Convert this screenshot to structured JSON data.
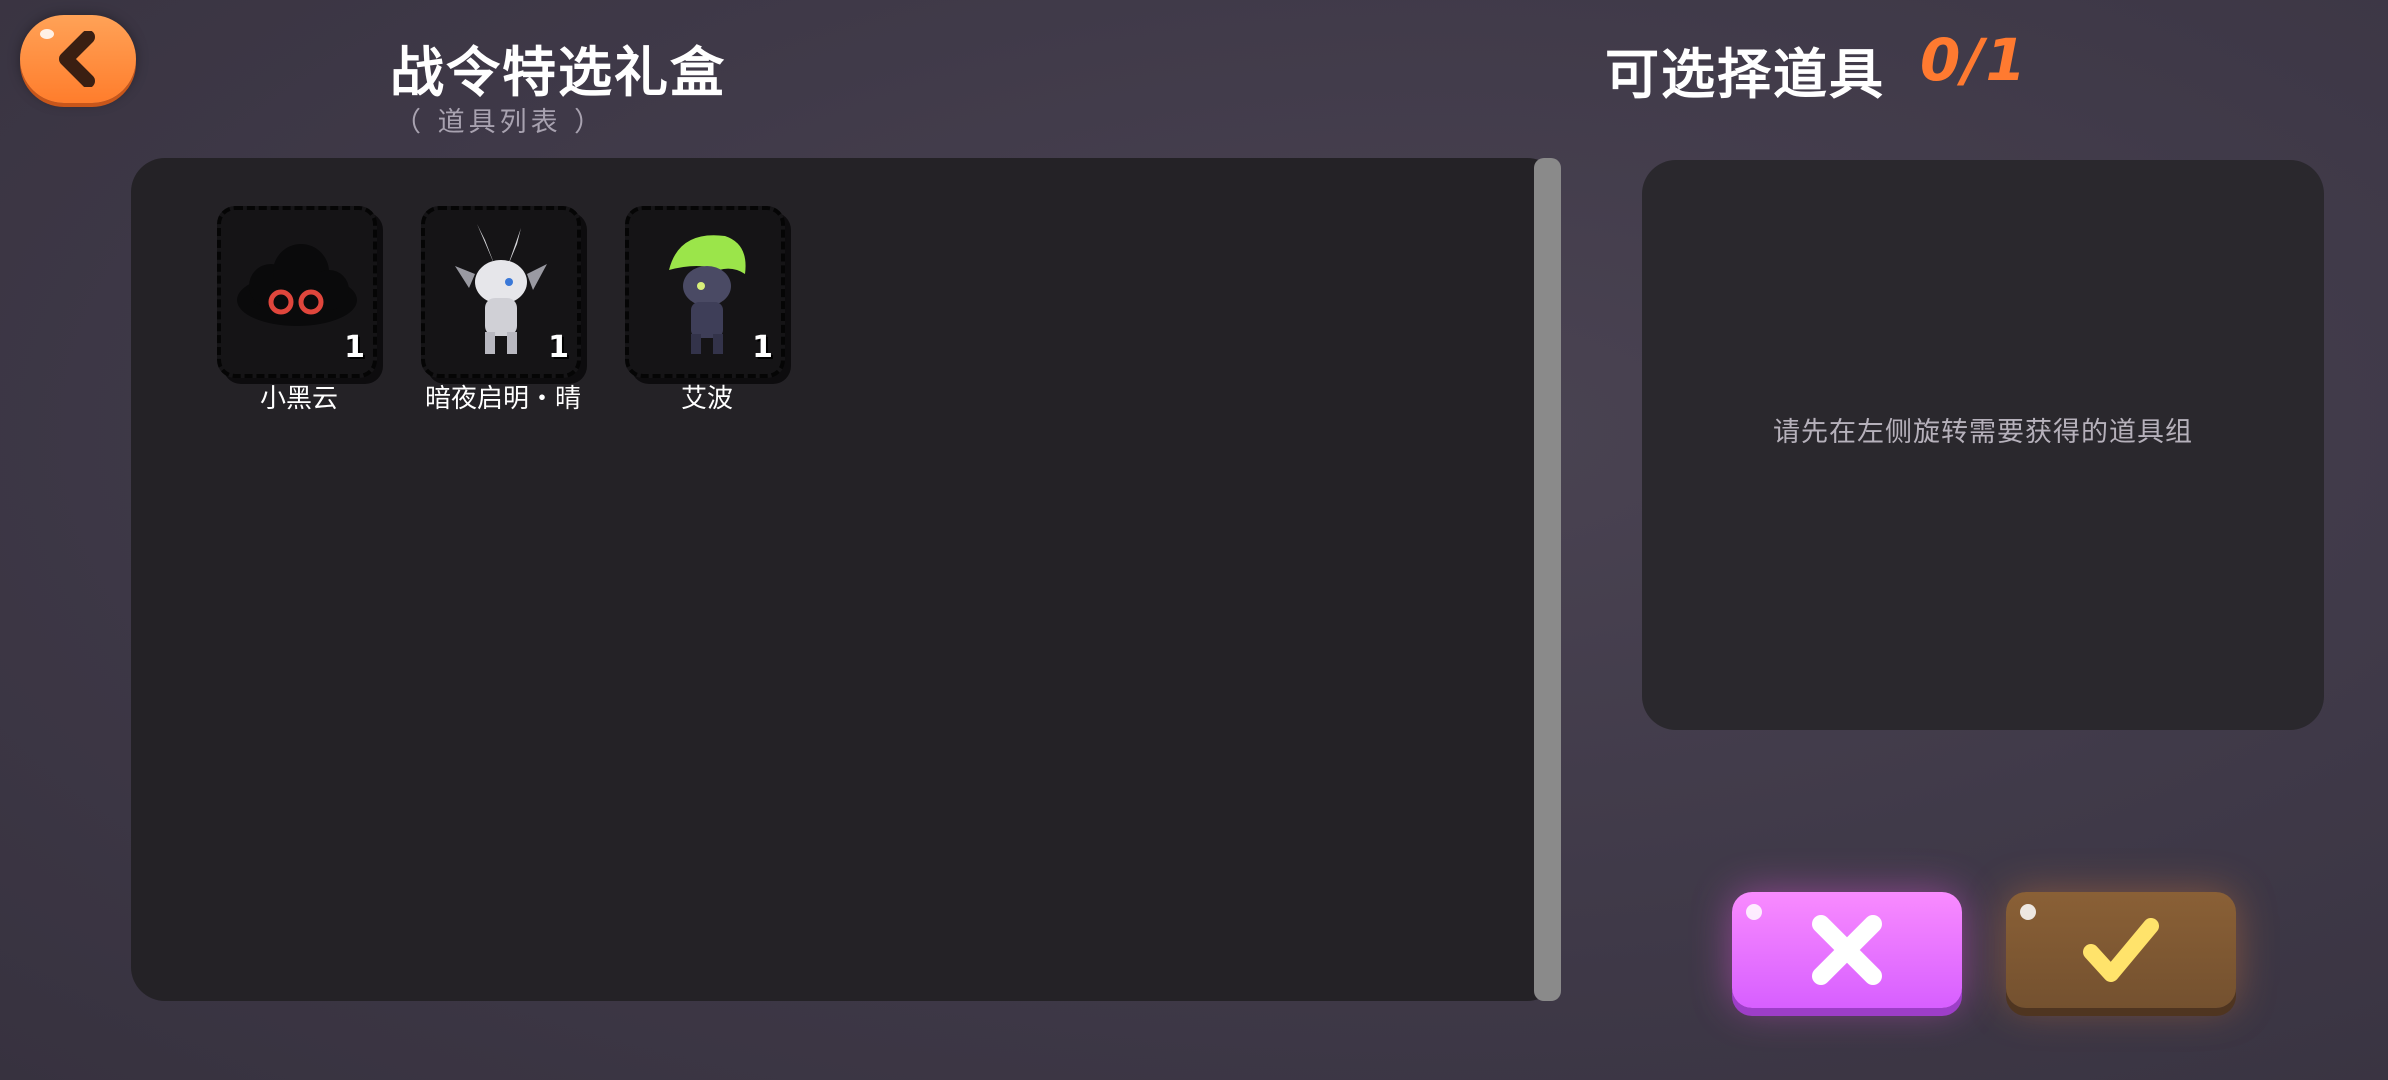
{
  "header": {
    "title": "战令特选礼盒",
    "subtitle": "（ 道具列表 ）",
    "selectable_label": "可选择道具",
    "selectable_count": "0/1",
    "back_icon": "chevron-left-icon"
  },
  "items": [
    {
      "name": "小黑云",
      "qty": "1",
      "icon": "black-cloud-icon"
    },
    {
      "name": "暗夜启明・晴",
      "qty": "1",
      "icon": "white-creature-icon"
    },
    {
      "name": "艾波",
      "qty": "1",
      "icon": "green-hair-creature-icon"
    }
  ],
  "detail": {
    "hint": "请先在左侧旋转需要获得的道具组"
  },
  "actions": {
    "cancel_icon": "close-icon",
    "confirm_icon": "check-icon"
  },
  "colors": {
    "accent_orange": "#ff7a30",
    "cancel_purple": "#e070ff",
    "confirm_brown": "#7d5832"
  }
}
